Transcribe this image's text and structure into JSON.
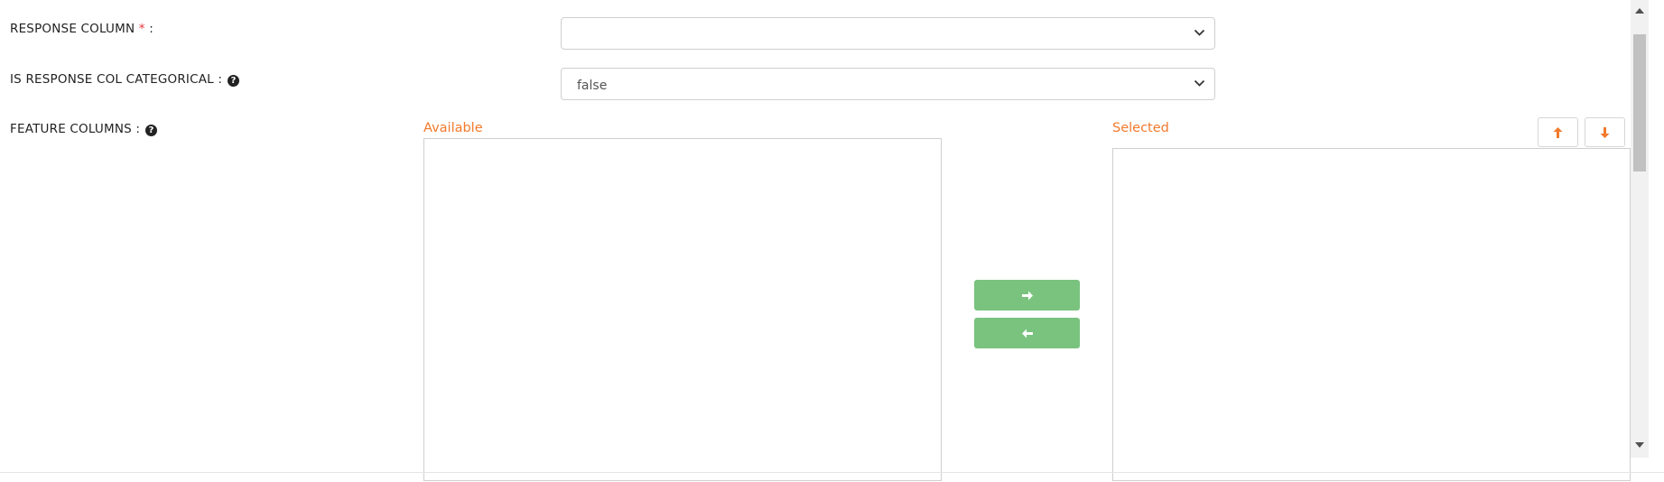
{
  "form": {
    "response_column": {
      "label": "RESPONSE COLUMN",
      "required_mark": "*",
      "colon": ":",
      "value": ""
    },
    "is_response_categorical": {
      "label": "IS RESPONSE COL CATEGORICAL :",
      "value": "false"
    },
    "feature_columns": {
      "label": "FEATURE COLUMNS :"
    }
  },
  "dual_list": {
    "available_title": "Available",
    "selected_title": "Selected"
  },
  "icons": {
    "help": "question-circle-icon",
    "move_right": "arrow-right-icon",
    "move_left": "arrow-left-icon",
    "move_up": "arrow-up-icon",
    "move_down": "arrow-down-icon",
    "dropdown": "chevron-down-icon"
  },
  "colors": {
    "accent": "#f27a2c",
    "move_button": "#79c37f",
    "required": "#e5343a"
  }
}
